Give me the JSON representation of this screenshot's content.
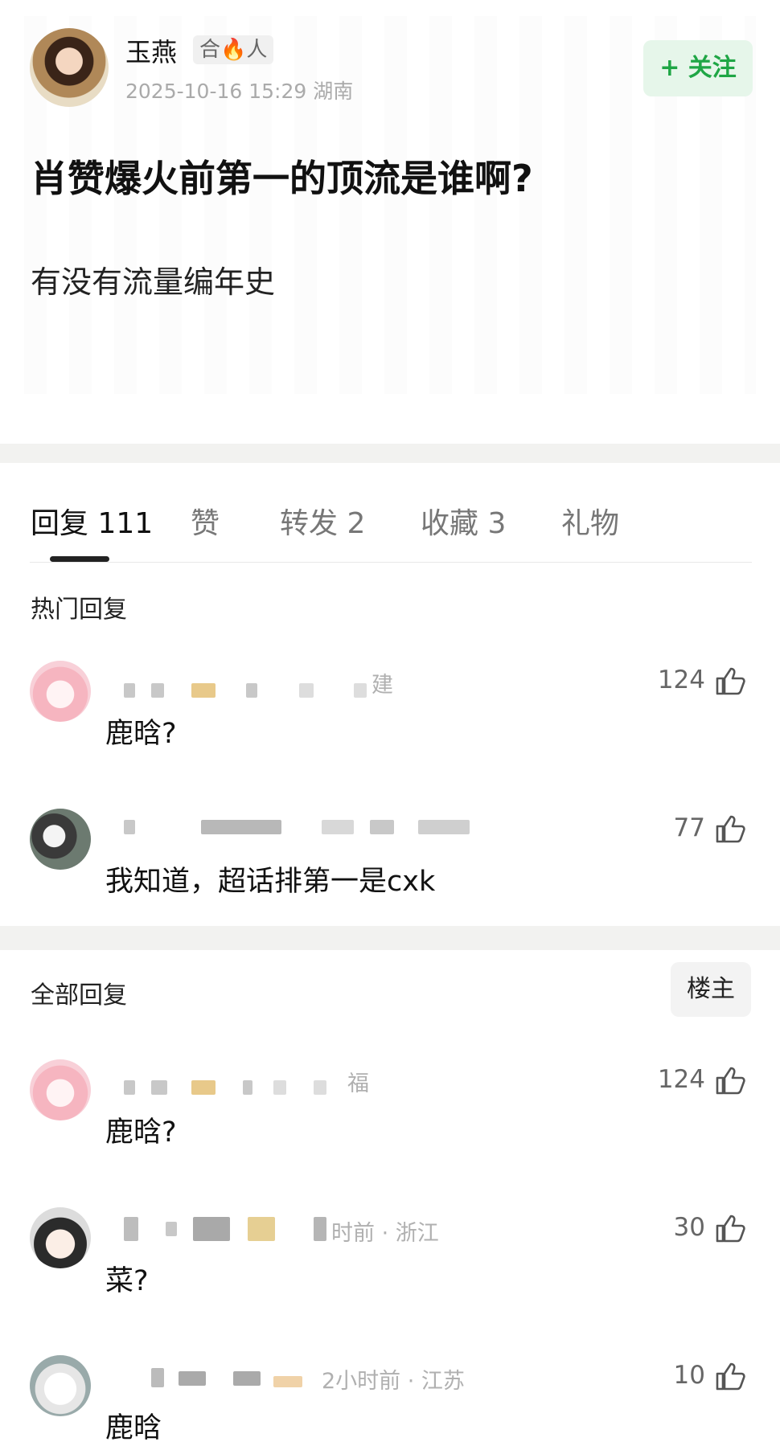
{
  "post": {
    "author_name": "玉燕",
    "author_badge": "合🔥人",
    "meta": "2025-10-16 15:29  湖南",
    "follow_label": "+ 关注",
    "title": "肖赞爆火前第一的顶流是谁啊?",
    "body": "有没有流量编年史"
  },
  "tabs": [
    {
      "label": "回复 111",
      "active": true
    },
    {
      "label": "赞",
      "active": false
    },
    {
      "label": "转发 2",
      "active": false
    },
    {
      "label": "收藏 3",
      "active": false
    },
    {
      "label": "礼物",
      "active": false
    }
  ],
  "hot_section": {
    "title": "热门回复",
    "comments": [
      {
        "meta_visible": "建",
        "text": "鹿晗?",
        "likes": "124",
        "avatar": "pink-cartoon-avatar"
      },
      {
        "meta_visible": "",
        "text": "我知道，超话排第一是cxk",
        "likes": "77",
        "avatar": "panda-avatar"
      }
    ]
  },
  "all_section": {
    "title": "全部回复",
    "op_filter_label": "楼主",
    "comments": [
      {
        "meta_visible": "福",
        "text": "鹿晗?",
        "likes": "124",
        "avatar": "pink-cartoon-avatar"
      },
      {
        "meta_visible": "时前 · 浙江",
        "text": "菜?",
        "likes": "30",
        "avatar": "boy-cartoon-avatar"
      },
      {
        "meta_visible": "2小时前 · 江苏",
        "text": "鹿晗",
        "likes": "10",
        "avatar": "bunny-avatar"
      }
    ]
  },
  "icons": {
    "like": "thumbs-up-icon"
  }
}
